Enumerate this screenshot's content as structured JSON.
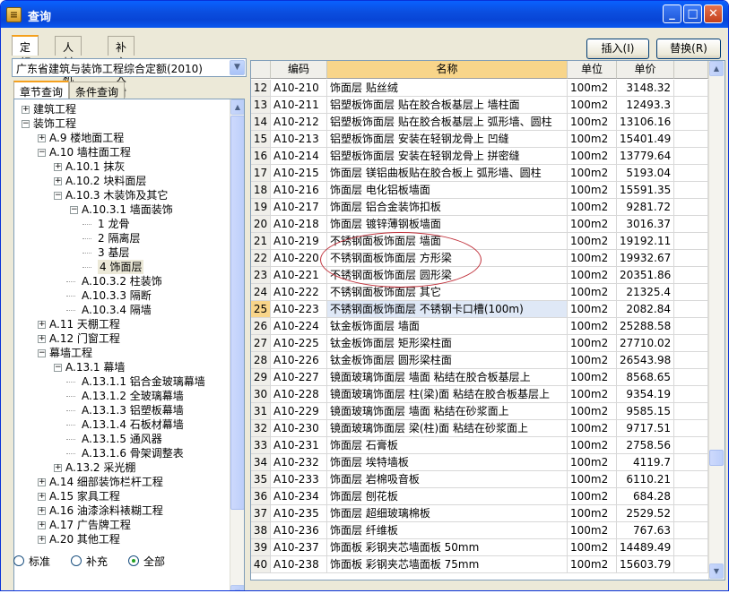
{
  "window": {
    "title": "查询",
    "minimize": "_",
    "maximize": "□",
    "close": "✕"
  },
  "top_tabs": [
    "定额",
    "人材机",
    "补充人材机"
  ],
  "buttons": {
    "insert": "插入(I)",
    "replace": "替换(R)"
  },
  "left": {
    "combo_value": "广东省建筑与装饰工程综合定额(2010)",
    "sub_tabs": [
      "章节查询",
      "条件查询"
    ],
    "tree": [
      {
        "level": 0,
        "exp": "+",
        "label": "建筑工程"
      },
      {
        "level": 0,
        "exp": "-",
        "label": "装饰工程"
      },
      {
        "level": 1,
        "exp": "+",
        "label": "A.9 楼地面工程"
      },
      {
        "level": 1,
        "exp": "-",
        "label": "A.10 墙柱面工程"
      },
      {
        "level": 2,
        "exp": "+",
        "label": "A.10.1 抹灰"
      },
      {
        "level": 2,
        "exp": "+",
        "label": "A.10.2 块料面层"
      },
      {
        "level": 2,
        "exp": "-",
        "label": "A.10.3 木装饰及其它"
      },
      {
        "level": 3,
        "exp": "-",
        "label": "A.10.3.1 墙面装饰"
      },
      {
        "level": 4,
        "exp": "",
        "label": "1 龙骨"
      },
      {
        "level": 4,
        "exp": "",
        "label": "2 隔离层"
      },
      {
        "level": 4,
        "exp": "",
        "label": "3 基层"
      },
      {
        "level": 4,
        "exp": "",
        "label": "4 饰面层",
        "selected": true
      },
      {
        "level": 3,
        "exp": "",
        "label": "A.10.3.2 柱装饰"
      },
      {
        "level": 3,
        "exp": "",
        "label": "A.10.3.3 隔断"
      },
      {
        "level": 3,
        "exp": "",
        "label": "A.10.3.4 隔墙"
      },
      {
        "level": 1,
        "exp": "+",
        "label": "A.11 天棚工程"
      },
      {
        "level": 1,
        "exp": "+",
        "label": "A.12 门窗工程"
      },
      {
        "level": 1,
        "exp": "-",
        "label": "幕墙工程"
      },
      {
        "level": 2,
        "exp": "-",
        "label": "A.13.1 幕墙"
      },
      {
        "level": 3,
        "exp": "",
        "label": "A.13.1.1 铝合金玻璃幕墙"
      },
      {
        "level": 3,
        "exp": "",
        "label": "A.13.1.2 全玻璃幕墙"
      },
      {
        "level": 3,
        "exp": "",
        "label": "A.13.1.3 铝塑板幕墙"
      },
      {
        "level": 3,
        "exp": "",
        "label": "A.13.1.4 石板材幕墙"
      },
      {
        "level": 3,
        "exp": "",
        "label": "A.13.1.5 通风器"
      },
      {
        "level": 3,
        "exp": "",
        "label": "A.13.1.6 骨架调整表"
      },
      {
        "level": 2,
        "exp": "+",
        "label": "A.13.2 采光棚"
      },
      {
        "level": 1,
        "exp": "+",
        "label": "A.14 细部装饰栏杆工程"
      },
      {
        "level": 1,
        "exp": "+",
        "label": "A.15 家具工程"
      },
      {
        "level": 1,
        "exp": "+",
        "label": "A.16 油漆涂料裱糊工程"
      },
      {
        "level": 1,
        "exp": "+",
        "label": "A.17 广告牌工程"
      },
      {
        "level": 1,
        "exp": "+",
        "label": "A.20 其他工程"
      }
    ],
    "radios": [
      {
        "label": "标准",
        "checked": false
      },
      {
        "label": "补充",
        "checked": false
      },
      {
        "label": "全部",
        "checked": true
      }
    ]
  },
  "grid": {
    "headers": [
      "编码",
      "名称",
      "单位",
      "单价"
    ],
    "current_row": "25",
    "rows": [
      [
        "12",
        "A10-210",
        "饰面层 贴丝绒",
        "100m2",
        "3148.32"
      ],
      [
        "13",
        "A10-211",
        "铝塑板饰面层 贴在胶合板基层上 墙柱面",
        "100m2",
        "12493.3"
      ],
      [
        "14",
        "A10-212",
        "铝塑板饰面层 贴在胶合板基层上 弧形墙、圆柱",
        "100m2",
        "13106.16"
      ],
      [
        "15",
        "A10-213",
        "铝塑板饰面层 安装在轻钢龙骨上 凹缝",
        "100m2",
        "15401.49"
      ],
      [
        "16",
        "A10-214",
        "铝塑板饰面层 安装在轻钢龙骨上 拼密缝",
        "100m2",
        "13779.64"
      ],
      [
        "17",
        "A10-215",
        "饰面层 镁铝曲板贴在胶合板上 弧形墙、圆柱",
        "100m2",
        "5193.04"
      ],
      [
        "18",
        "A10-216",
        "饰面层 电化铝板墙面",
        "100m2",
        "15591.35"
      ],
      [
        "19",
        "A10-217",
        "饰面层 铝合金装饰扣板",
        "100m2",
        "9281.72"
      ],
      [
        "20",
        "A10-218",
        "饰面层 镀锌薄钢板墙面",
        "100m2",
        "3016.37"
      ],
      [
        "21",
        "A10-219",
        "不锈钢面板饰面层  墙面",
        "100m2",
        "19192.11"
      ],
      [
        "22",
        "A10-220",
        "不锈钢面板饰面层  方形梁",
        "100m2",
        "19932.67"
      ],
      [
        "23",
        "A10-221",
        "不锈钢面板饰面层  圆形梁",
        "100m2",
        "20351.86"
      ],
      [
        "24",
        "A10-222",
        "不锈钢面板饰面层  其它",
        "100m2",
        "21325.4"
      ],
      [
        "25",
        "A10-223",
        "不锈钢面板饰面层  不锈钢卡口槽(100m)",
        "100m2",
        "2082.84"
      ],
      [
        "26",
        "A10-224",
        "钛金板饰面层 墙面",
        "100m2",
        "25288.58"
      ],
      [
        "27",
        "A10-225",
        "钛金板饰面层 矩形梁柱面",
        "100m2",
        "27710.02"
      ],
      [
        "28",
        "A10-226",
        "钛金板饰面层 圆形梁柱面",
        "100m2",
        "26543.98"
      ],
      [
        "29",
        "A10-227",
        "镜面玻璃饰面层  墙面 粘结在胶合板基层上",
        "100m2",
        "8568.65"
      ],
      [
        "30",
        "A10-228",
        "镜面玻璃饰面层  柱(梁)面 粘结在胶合板基层上",
        "100m2",
        "9354.19"
      ],
      [
        "31",
        "A10-229",
        "镜面玻璃饰面层  墙面 粘结在砂浆面上",
        "100m2",
        "9585.15"
      ],
      [
        "32",
        "A10-230",
        "镜面玻璃饰面层  梁(柱)面 粘结在砂浆面上",
        "100m2",
        "9717.51"
      ],
      [
        "33",
        "A10-231",
        "饰面层 石膏板",
        "100m2",
        "2758.56"
      ],
      [
        "34",
        "A10-232",
        "饰面层 埃特墙板",
        "100m2",
        "4119.7"
      ],
      [
        "35",
        "A10-233",
        "饰面层 岩棉吸音板",
        "100m2",
        "6110.21"
      ],
      [
        "36",
        "A10-234",
        "饰面层 刨花板",
        "100m2",
        "684.28"
      ],
      [
        "37",
        "A10-235",
        "饰面层 超细玻璃棉板",
        "100m2",
        "2529.52"
      ],
      [
        "38",
        "A10-236",
        "饰面层 纤维板",
        "100m2",
        "767.63"
      ],
      [
        "39",
        "A10-237",
        "饰面板 彩钢夹芯墙面板 50mm",
        "100m2",
        "14489.49"
      ],
      [
        "40",
        "A10-238",
        "饰面板 彩钢夹芯墙面板 75mm",
        "100m2",
        "15603.79"
      ]
    ]
  },
  "colors": {
    "titlebar": "#0a58f0",
    "highlight_header": "#f8d58a",
    "annotation_ellipse": "#c0303a"
  }
}
